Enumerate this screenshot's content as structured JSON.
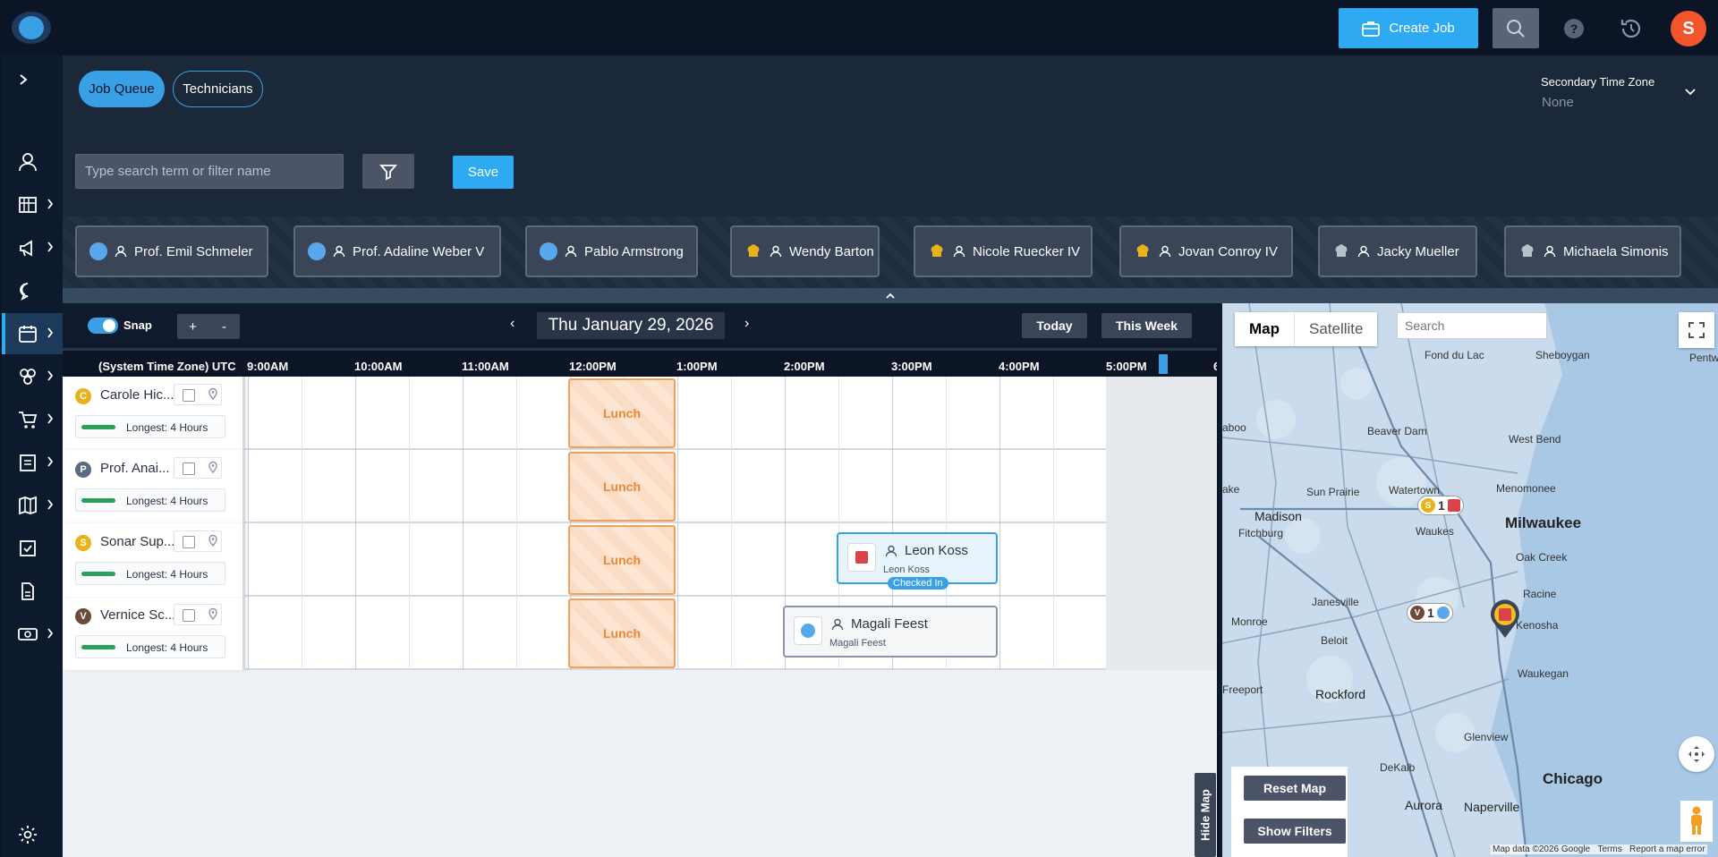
{
  "header": {
    "create_job_label": "Create Job",
    "user_initial": "S",
    "accent": "#2eaaf2",
    "avatar_color": "#f2552c"
  },
  "tabs": [
    {
      "label": "Job Queue",
      "active": true
    },
    {
      "label": "Technicians",
      "active": false
    }
  ],
  "secondary_tz": {
    "label": "Secondary Time Zone",
    "value": "None"
  },
  "filter": {
    "placeholder": "Type search term or filter name",
    "save_label": "Save"
  },
  "technicians": [
    {
      "name": "Prof. Emil Schmeler",
      "icon": "blue-dot"
    },
    {
      "name": "Prof. Adaline Weber V",
      "icon": "blue-dot"
    },
    {
      "name": "Pablo Armstrong",
      "icon": "blue-dot"
    },
    {
      "name": "Wendy Barton",
      "icon": "gold-hat"
    },
    {
      "name": "Nicole Ruecker IV",
      "icon": "gold-hat"
    },
    {
      "name": "Jovan Conroy IV",
      "icon": "gold-hat"
    },
    {
      "name": "Jacky Mueller",
      "icon": "gray-hat"
    },
    {
      "name": "Michaela Simonis",
      "icon": "gray-hat"
    }
  ],
  "schedule": {
    "snap_label": "Snap",
    "zoom_in": "+",
    "zoom_out": "-",
    "prev": "‹",
    "next": "›",
    "date": "Thu January 29, 2026",
    "today_label": "Today",
    "week_label": "This Week",
    "tz_axis_label": "(System Time Zone) UTC",
    "hours": [
      "9:00AM",
      "10:00AM",
      "11:00AM",
      "12:00PM",
      "1:00PM",
      "2:00PM",
      "3:00PM",
      "4:00PM",
      "5:00PM",
      "6"
    ]
  },
  "rows": [
    {
      "initial": "C",
      "color": "#e8b21a",
      "name": "Carole Hic...",
      "longest": "Longest: 4 Hours"
    },
    {
      "initial": "P",
      "color": "#5a6b80",
      "name": "Prof. Anai...",
      "longest": "Longest: 4 Hours"
    },
    {
      "initial": "S",
      "color": "#e8b21a",
      "name": "Sonar Sup...",
      "longest": "Longest: 4 Hours"
    },
    {
      "initial": "V",
      "color": "#6b4a3a",
      "name": "Vernice Sc...",
      "longest": "Longest: 4 Hours"
    }
  ],
  "lunch_label": "Lunch",
  "jobs": [
    {
      "title": "Leon Koss",
      "sub": "Leon Koss",
      "status": "Checked In",
      "icon_color": "#d9434a"
    },
    {
      "title": "Magali Feest",
      "sub": "Magali Feest",
      "icon_color": "#5aa8ec"
    }
  ],
  "map": {
    "tab_map": "Map",
    "tab_satellite": "Satellite",
    "search_placeholder": "Search",
    "reset_label": "Reset Map",
    "filters_label": "Show Filters",
    "hide_label": "Hide Map",
    "places": {
      "fond_du_lac": "Fond du Lac",
      "sheboygan": "Sheboygan",
      "beaver_dam": "Beaver Dam",
      "west_bend": "West Bend",
      "watertown": "Watertown",
      "menomonee": "Menomonee",
      "sun_prairie": "Sun Prairie",
      "madison": "Madison",
      "fitchburg": "Fitchburg",
      "milwaukee": "Milwaukee",
      "waukesha": "Waukes",
      "oak_creek": "Oak Creek",
      "racine": "Racine",
      "janesville": "Janesville",
      "kenosha": "Kenosha",
      "monroe": "Monroe",
      "beloit": "Beloit",
      "waukegan": "Waukegan",
      "freeport": "Freeport",
      "rockford": "Rockford",
      "glenview": "Glenview",
      "dekalb": "DeKalb",
      "chicago": "Chicago",
      "aurora": "Aurora",
      "naperville": "Naperville",
      "baraboo": "aboo",
      "lake": "ake",
      "pent": "Pentw"
    },
    "clusters": [
      {
        "letter": "S",
        "count": "1",
        "letter_color": "#e8b21a",
        "second": "red"
      },
      {
        "letter": "V",
        "count": "1",
        "letter_color": "#6b4a3a",
        "second": "blue"
      }
    ],
    "footer": {
      "data": "Map data ©2026 Google",
      "terms": "Terms",
      "report": "Report a map error"
    }
  }
}
